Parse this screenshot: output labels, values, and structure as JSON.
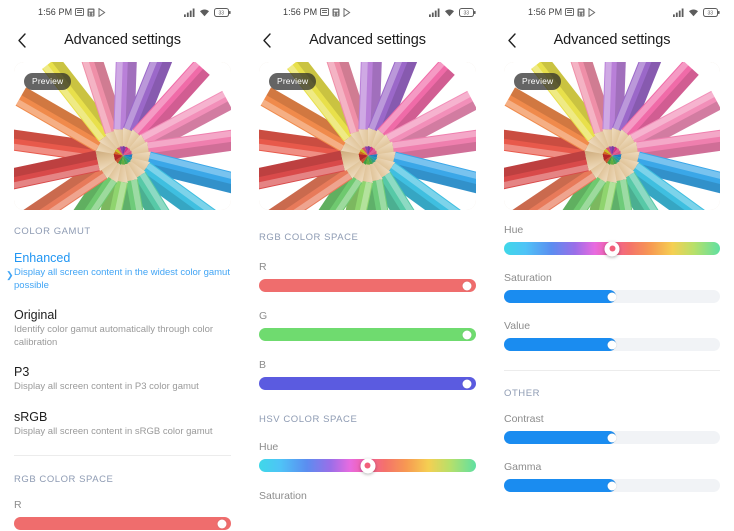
{
  "status_bar": {
    "time": "1:56 PM",
    "left_icons": [
      "sim-card-icon",
      "calculator-icon",
      "play-store-icon"
    ],
    "right_icons": [
      "signal-bars-icon",
      "wifi-icon",
      "battery-icon"
    ],
    "battery_level": "33"
  },
  "header": {
    "back_icon": "chevron-left-icon",
    "title": "Advanced settings"
  },
  "preview": {
    "badge": "Preview",
    "image_alt": "colored-pencils-radial"
  },
  "colors": {
    "accent_blue": "#2196f3",
    "slider_blue": "#1a8cf0",
    "slider_red": "#ef6d6d",
    "slider_green": "#6fdb6f",
    "slider_blue_rgb": "#5b5be0",
    "section_head": "#8e9bb3",
    "track_bg": "#f1f3f6"
  },
  "panel1": {
    "section_color_gamut": "COLOR GAMUT",
    "options": [
      {
        "title": "Enhanced",
        "desc": "Display all screen content in the widest color gamut possible",
        "selected": true
      },
      {
        "title": "Original",
        "desc": "Identify color gamut automatically through color calibration",
        "selected": false
      },
      {
        "title": "P3",
        "desc": "Display all screen content in P3 color gamut",
        "selected": false
      },
      {
        "title": "sRGB",
        "desc": "Display all screen content in sRGB color gamut",
        "selected": false
      }
    ],
    "section_rgb": "RGB COLOR SPACE",
    "slider_r_label": "R",
    "slider_r_value": 100
  },
  "panel2": {
    "section_rgb": "RGB COLOR SPACE",
    "rgb_sliders": [
      {
        "label": "R",
        "value": 100,
        "color": "#ef6d6d"
      },
      {
        "label": "G",
        "value": 100,
        "color": "#6fdb6f"
      },
      {
        "label": "B",
        "value": 100,
        "color": "#5b5be0"
      }
    ],
    "section_hsv": "HSV COLOR SPACE",
    "hue_label": "Hue",
    "hue_value": 50,
    "saturation_label": "Saturation"
  },
  "panel3": {
    "hue_label": "Hue",
    "hue_value": 50,
    "saturation_label": "Saturation",
    "saturation_value": 50,
    "value_label": "Value",
    "value_value": 50,
    "section_other": "OTHER",
    "contrast_label": "Contrast",
    "contrast_value": 50,
    "gamma_label": "Gamma",
    "gamma_value": 50
  }
}
